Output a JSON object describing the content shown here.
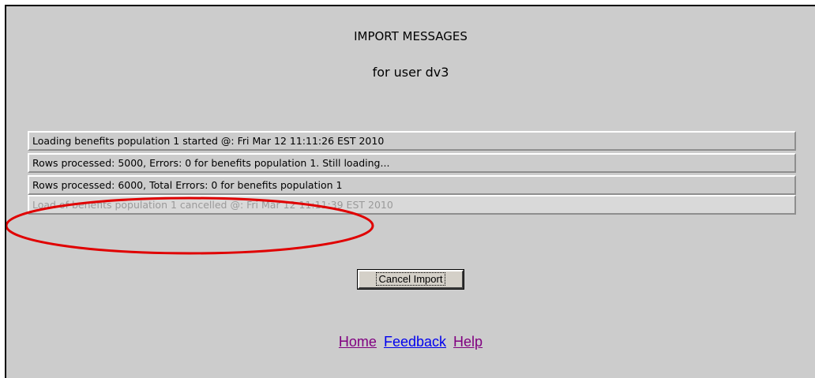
{
  "header": {
    "title": "IMPORT MESSAGES",
    "subtitle": "for user dv3"
  },
  "messages": [
    {
      "text": "Loading benefits population 1 started @: Fri Mar 12 11:11:26 EST 2010"
    },
    {
      "text": "Rows processed: 5000, Errors: 0 for benefits population 1. Still loading..."
    },
    {
      "text": "Rows processed: 6000, Total Errors: 0 for benefits population 1"
    },
    {
      "text": "Load of benefits population 1 cancelled @: Fri Mar 12 11:11:39 EST 2010"
    }
  ],
  "actions": {
    "cancel_label": "Cancel Import"
  },
  "footer": {
    "home_label": "Home",
    "feedback_label": "Feedback",
    "help_label": "Help"
  },
  "colors": {
    "background": "#cccccc",
    "annotation_ellipse": "#e00000",
    "link_visited": "#800080",
    "link": "#0000ee"
  }
}
